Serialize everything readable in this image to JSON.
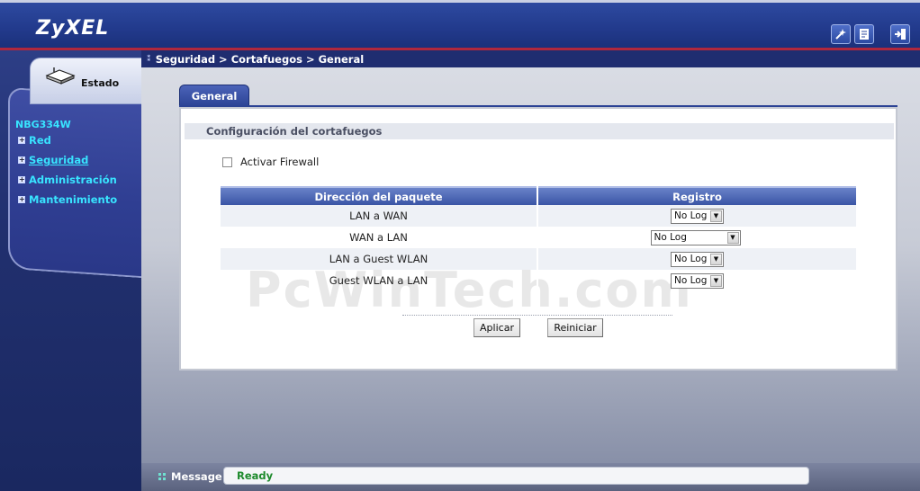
{
  "header": {
    "logo": "ZyXEL",
    "tools": [
      {
        "name": "wizard-icon"
      },
      {
        "name": "notes-icon"
      },
      {
        "name": "logout-icon"
      }
    ]
  },
  "breadcrumb": "Seguridad > Cortafuegos > General",
  "sidebar": {
    "estado_label": "Estado",
    "device_name": "NBG334W",
    "items": [
      {
        "label": "Red"
      },
      {
        "label": "Seguridad"
      },
      {
        "label": "Administración"
      },
      {
        "label": "Mantenimiento"
      }
    ]
  },
  "main": {
    "tab_label": "General",
    "section_title": "Configuración del cortafuegos",
    "firewall_checkbox_label": "Activar Firewall",
    "firewall_enabled": false,
    "table": {
      "headers": [
        "Dirección del paquete",
        "Registro"
      ],
      "rows": [
        {
          "direction": "LAN a WAN",
          "log": "No Log"
        },
        {
          "direction": "WAN a LAN",
          "log": "No Log"
        },
        {
          "direction": "LAN a Guest WLAN",
          "log": "No Log"
        },
        {
          "direction": "Guest WLAN a LAN",
          "log": "No Log"
        }
      ]
    },
    "apply_button": "Aplicar",
    "reset_button": "Reiniciar",
    "watermark": "PcWinTech.com"
  },
  "status": {
    "label": "Message",
    "value": "Ready"
  },
  "colors": {
    "accent": "#2b4294",
    "menu_text": "#38e4ff",
    "status_ok": "#1d8a2c"
  }
}
